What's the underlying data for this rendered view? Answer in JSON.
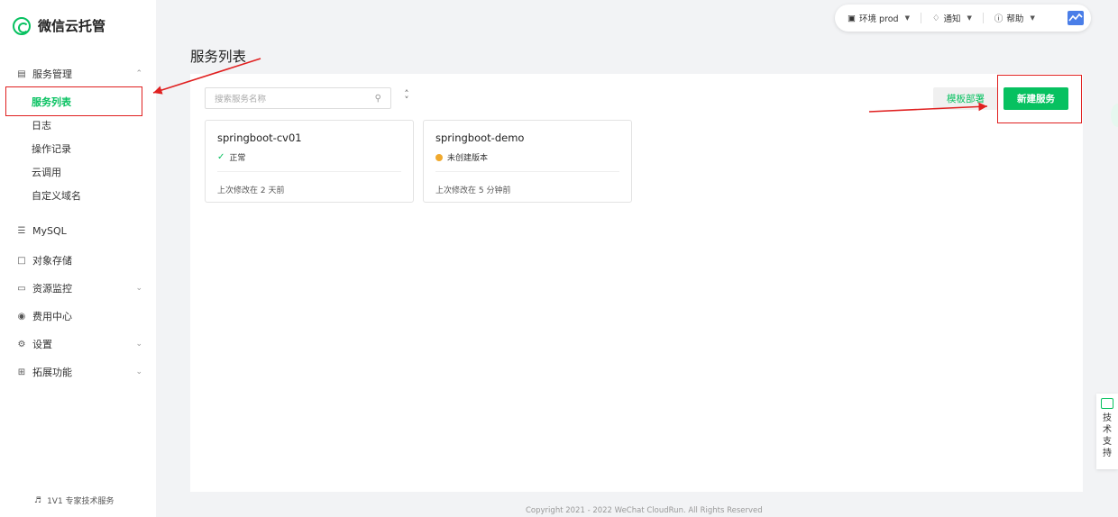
{
  "app": {
    "title": "微信云托管"
  },
  "sidebar": {
    "groups": [
      {
        "label": "服务管理",
        "icon": "server-icon",
        "expanded": true
      },
      {
        "label": "MySQL",
        "icon": "database-icon"
      },
      {
        "label": "对象存储",
        "icon": "folder-icon"
      },
      {
        "label": "资源监控",
        "icon": "monitor-icon",
        "expanded": false
      },
      {
        "label": "费用中心",
        "icon": "coin-icon"
      },
      {
        "label": "设置",
        "icon": "gear-icon",
        "expanded": false
      },
      {
        "label": "拓展功能",
        "icon": "grid-icon",
        "expanded": false
      }
    ],
    "sub_items": [
      {
        "label": "服务列表",
        "active": true
      },
      {
        "label": "日志"
      },
      {
        "label": "操作记录"
      },
      {
        "label": "云调用"
      },
      {
        "label": "自定义域名"
      }
    ],
    "footer": "1V1 专家技术服务"
  },
  "topbar": {
    "env_label": "环境 prod",
    "notify_label": "通知",
    "help_label": "帮助"
  },
  "main": {
    "title": "服务列表",
    "search_placeholder": "搜索服务名称",
    "template_button": "模板部署",
    "new_button": "新建服务",
    "cards": [
      {
        "name": "springboot-cv01",
        "status": "正常",
        "status_type": "ok",
        "updated": "上次修改在 2 天前"
      },
      {
        "name": "springboot-demo",
        "status": "未创建版本",
        "status_type": "pending",
        "updated": "上次修改在 5 分钟前"
      }
    ]
  },
  "support": {
    "label_chars": [
      "技",
      "术",
      "支",
      "持"
    ]
  },
  "footer": {
    "copyright": "Copyright 2021 - 2022 WeChat CloudRun. All Rights Reserved"
  },
  "colors": {
    "brand": "#07c160",
    "annotation": "#e02020",
    "pending": "#f0a92e"
  }
}
